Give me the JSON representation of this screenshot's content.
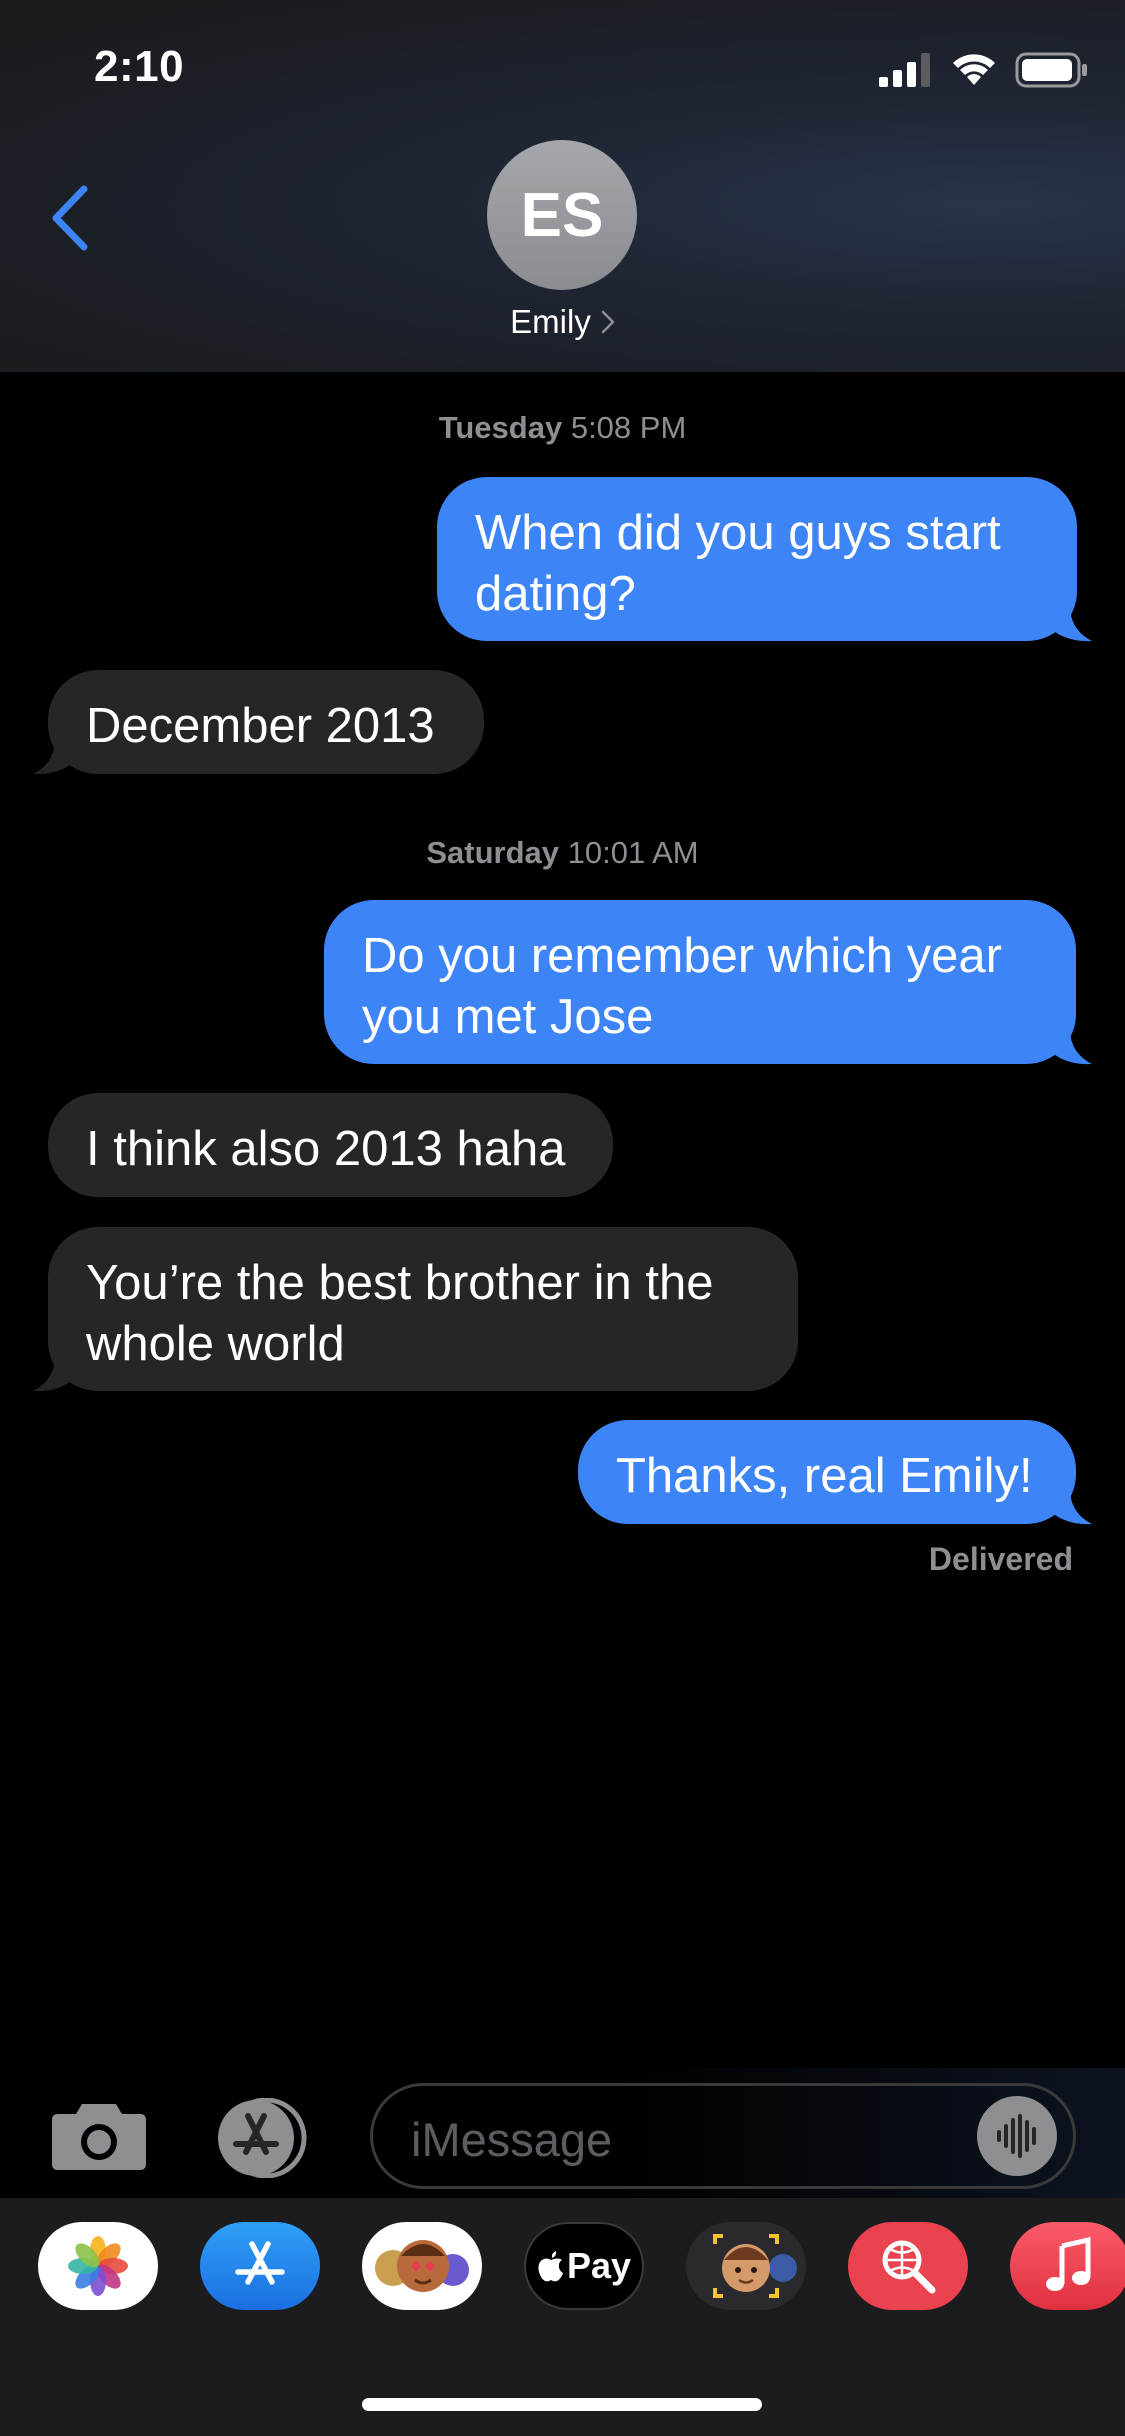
{
  "status_bar": {
    "time": "2:10"
  },
  "header": {
    "back_icon": "chevron-left-icon",
    "avatar_initials": "ES",
    "contact_name": "Emily",
    "accent_color": "#3d84f7"
  },
  "conversation": {
    "timestamps": [
      {
        "day": "Tuesday",
        "time": "5:08 PM"
      },
      {
        "day": "Saturday",
        "time": "10:01 AM"
      }
    ],
    "messages": [
      {
        "direction": "sent",
        "lines": [
          "When did you guys start",
          "dating?"
        ]
      },
      {
        "direction": "received",
        "lines": [
          "December 2013"
        ]
      },
      {
        "direction": "sent",
        "lines": [
          "Do you remember which year",
          "you met Jose"
        ]
      },
      {
        "direction": "received",
        "lines": [
          "I think also 2013 haha"
        ]
      },
      {
        "direction": "received",
        "lines": [
          "You’re the best brother in the",
          "whole world"
        ]
      },
      {
        "direction": "sent",
        "lines": [
          "Thanks, real Emily!"
        ]
      }
    ],
    "delivered_label": "Delivered"
  },
  "input_bar": {
    "placeholder": "iMessage",
    "camera_icon": "camera-icon",
    "apps_icon": "app-store-icon",
    "audio_icon": "audio-waveform-icon"
  },
  "app_drawer": {
    "apps": [
      "photos",
      "app-store",
      "memoji-stickers",
      "apple-pay",
      "animoji",
      "images-search",
      "music"
    ],
    "apple_pay_label": "Pay"
  },
  "colors": {
    "sent_bubble": "#3d84f7",
    "received_bubble": "#262629",
    "secondary_text": "#8e8e93"
  }
}
